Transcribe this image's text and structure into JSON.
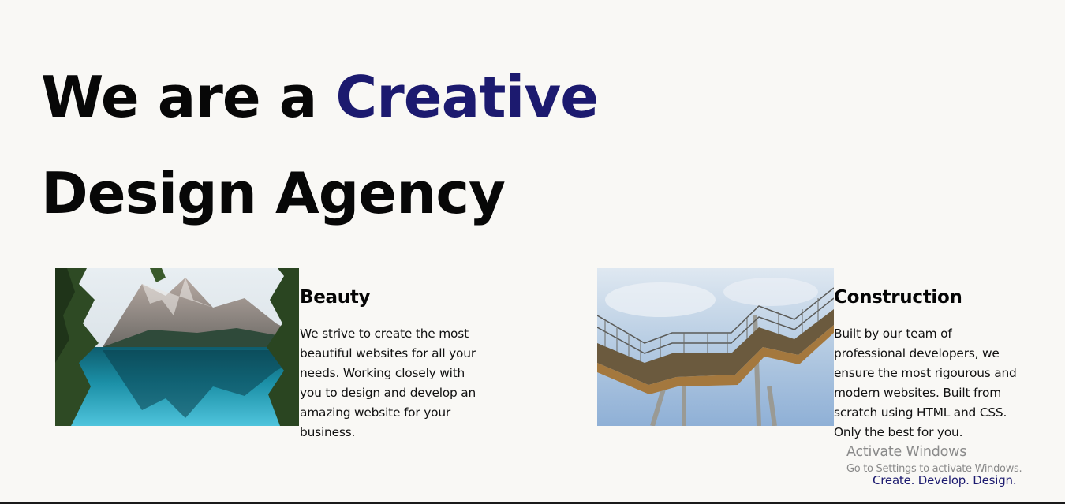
{
  "hero": {
    "line1_prefix": "We are a ",
    "line1_accent": "Creative",
    "line2": "Design Agency"
  },
  "cards": [
    {
      "title": "Beauty",
      "body": "We strive to create the most beautiful websites for all your needs. Working closely with you to design and develop an amazing website for your business.",
      "image": "mountain-lake-photo"
    },
    {
      "title": "Construction",
      "body": "Built by our team of professional developers, we ensure the most rigourous and modern websites. Built from scratch using HTML and CSS. Only the best for you.",
      "image": "walkway-structure-photo"
    }
  ],
  "footer": {
    "tagline": "Create. Develop. Design."
  },
  "os_watermark": {
    "title": "Activate Windows",
    "subtitle": "Go to Settings to activate Windows."
  },
  "colors": {
    "accent": "#1c1a6f",
    "background": "#f9f8f5",
    "text": "#070707"
  }
}
